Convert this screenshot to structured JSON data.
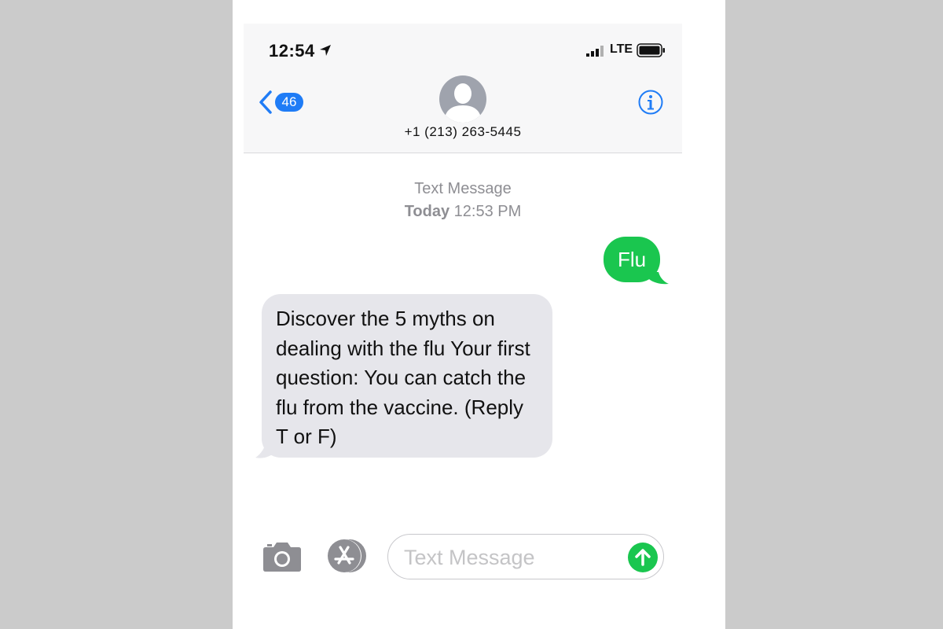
{
  "status_bar": {
    "time": "12:54",
    "network": "LTE",
    "icons": [
      "location-arrow-icon",
      "cellular-signal-icon",
      "battery-icon"
    ]
  },
  "nav": {
    "back_badge": "46",
    "contact_name": "+1 (213) 263-5445",
    "icons": [
      "chevron-left-icon",
      "contact-avatar-icon",
      "info-icon"
    ]
  },
  "thread": {
    "service_label": "Text Message",
    "day_label": "Today",
    "time_label": " 12:53 PM"
  },
  "messages": [
    {
      "direction": "outgoing",
      "text": "Flu"
    },
    {
      "direction": "incoming",
      "text": "Discover the 5 myths on dealing with the flu Your first question: You can catch the flu from the vaccine. (Reply T or F)"
    }
  ],
  "compose": {
    "placeholder": "Text Message",
    "value": "",
    "icons": [
      "camera-icon",
      "app-store-icon",
      "send-arrow-icon"
    ]
  },
  "colors": {
    "accent_blue": "#1f7cf6",
    "sms_green": "#1ac64f",
    "incoming_bubble": "#e6e6eb",
    "page_background": "#cbcbcb"
  }
}
